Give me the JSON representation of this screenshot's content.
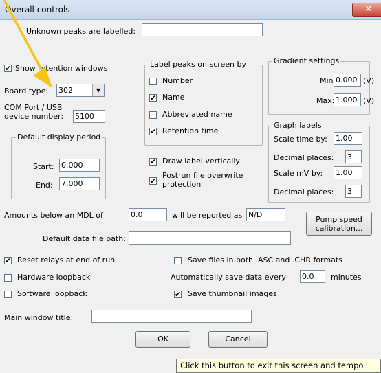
{
  "window": {
    "title": "Overall controls",
    "close_glyph": "✕"
  },
  "fields": {
    "unknown_peaks_label": "Unknown peaks are labelled:",
    "unknown_peaks_value": "",
    "show_retention_label": "Show retention windows",
    "board_type_label": "Board type:",
    "board_type_value": "302",
    "com_port_label_1": "COM Port / USB",
    "com_port_label_2": "device number:",
    "com_port_value": "5100",
    "mdl_label": "Amounts below an MDL of",
    "mdl_value": "0.0",
    "reported_as_label": "will be reported as",
    "reported_as_value": "N/D",
    "data_path_label": "Default data file path:",
    "data_path_value": "",
    "main_title_label": "Main window title:",
    "main_title_value": "",
    "auto_save_label": "Automatically save data every",
    "auto_save_value": "0.0",
    "minutes_label": "minutes"
  },
  "display_period": {
    "legend": "Default display period",
    "start_label": "Start:",
    "start_value": "0.000",
    "end_label": "End:",
    "end_value": "7.000"
  },
  "label_peaks": {
    "legend": "Label peaks on screen by",
    "number": "Number",
    "name": "Name",
    "abbreviated": "Abbreviated name",
    "retention": "Retention time"
  },
  "gradient": {
    "legend": "Gradient settings",
    "min_label": "Min:",
    "min_value": "0.000",
    "max_label": "Max:",
    "max_value": "1.000",
    "unit": "(V)"
  },
  "graph_labels": {
    "legend": "Graph labels",
    "scale_time_label": "Scale time by:",
    "scale_time_value": "1.00",
    "decimal1_label": "Decimal places:",
    "decimal1_value": "3",
    "scale_mv_label": "Scale mV by:",
    "scale_mv_value": "1.00",
    "decimal2_label": "Decimal places:",
    "decimal2_value": "3"
  },
  "checks": {
    "draw_vertical": "Draw label vertically",
    "postrun_1": "Postrun file overwrite",
    "postrun_2": "protection",
    "reset_relays": "Reset relays at end of run",
    "hardware_loopback": "Hardware loopback",
    "software_loopback": "Software loopback",
    "save_both": "Save files in both .ASC and .CHR formats",
    "save_thumbnails": "Save thumbnail images",
    "checkmark": "✔"
  },
  "buttons": {
    "pump_1": "Pump speed",
    "pump_2": "calibration...",
    "ok": "OK",
    "cancel": "Cancel"
  },
  "tooltip": "Click this button to exit this screen and tempo",
  "colors": {
    "annotation_arrow": "#f5c518"
  }
}
